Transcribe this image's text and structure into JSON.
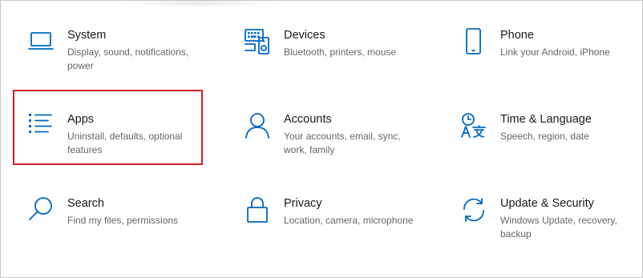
{
  "tiles": [
    {
      "id": "system",
      "title": "System",
      "desc": "Display, sound, notifications, power",
      "icon": "laptop-icon"
    },
    {
      "id": "devices",
      "title": "Devices",
      "desc": "Bluetooth, printers, mouse",
      "icon": "keyboard-speaker-icon"
    },
    {
      "id": "phone",
      "title": "Phone",
      "desc": "Link your Android, iPhone",
      "icon": "phone-icon"
    },
    {
      "id": "apps",
      "title": "Apps",
      "desc": "Uninstall, defaults, optional features",
      "icon": "apps-list-icon"
    },
    {
      "id": "accounts",
      "title": "Accounts",
      "desc": "Your accounts, email, sync, work, family",
      "icon": "person-icon"
    },
    {
      "id": "time",
      "title": "Time & Language",
      "desc": "Speech, region, date",
      "icon": "language-icon"
    },
    {
      "id": "search",
      "title": "Search",
      "desc": "Find my files, permissions",
      "icon": "search-icon"
    },
    {
      "id": "privacy",
      "title": "Privacy",
      "desc": "Location, camera, microphone",
      "icon": "lock-icon"
    },
    {
      "id": "update",
      "title": "Update & Security",
      "desc": "Windows Update, recovery, backup",
      "icon": "sync-icon"
    }
  ],
  "accent_color": "#0067c0",
  "highlight_color": "#d11f2b"
}
